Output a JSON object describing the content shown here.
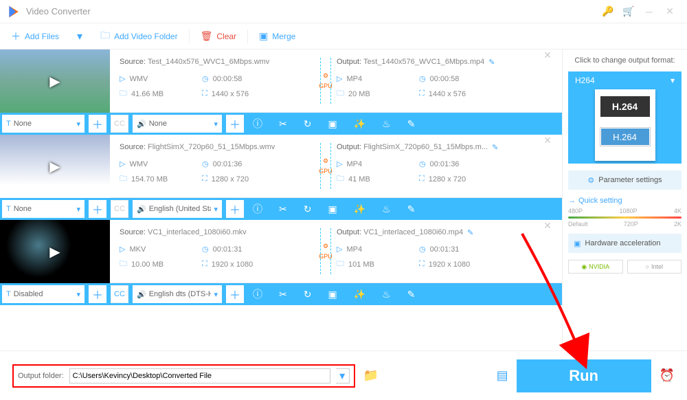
{
  "app": {
    "title": "Video Converter"
  },
  "toolbar": {
    "add_files": "Add Files",
    "add_folder": "Add Video Folder",
    "clear": "Clear",
    "merge": "Merge"
  },
  "rows": [
    {
      "source_label": "Source:",
      "source_name": "Test_1440x576_WVC1_6Mbps.wmv",
      "src_format": "WMV",
      "src_dur": "00:00:58",
      "src_size": "41.66 MB",
      "src_res": "1440 x 576",
      "output_label": "Output:",
      "output_name": "Test_1440x576_WVC1_6Mbps.mp4",
      "out_format": "MP4",
      "out_dur": "00:00:58",
      "out_size": "20 MB",
      "out_res": "1440 x 576",
      "subtitle": "None",
      "audio": "None",
      "cc_active": false,
      "gpu": "GPU"
    },
    {
      "source_label": "Source:",
      "source_name": "FlightSimX_720p60_51_15Mbps.wmv",
      "src_format": "WMV",
      "src_dur": "00:01:36",
      "src_size": "154.70 MB",
      "src_res": "1280 x 720",
      "output_label": "Output:",
      "output_name": "FlightSimX_720p60_51_15Mbps.m...",
      "out_format": "MP4",
      "out_dur": "00:01:36",
      "out_size": "41 MB",
      "out_res": "1280 x 720",
      "subtitle": "None",
      "audio": "English (United State",
      "cc_active": false,
      "gpu": "GPU"
    },
    {
      "source_label": "Source:",
      "source_name": "VC1_interlaced_1080i60.mkv",
      "src_format": "MKV",
      "src_dur": "00:01:31",
      "src_size": "10.00 MB",
      "src_res": "1920 x 1080",
      "output_label": "Output:",
      "output_name": "VC1_interlaced_1080i60.mp4",
      "out_format": "MP4",
      "out_dur": "00:01:31",
      "out_size": "101 MB",
      "out_res": "1920 x 1080",
      "subtitle": "Disabled",
      "audio": "English dts (DTS-HD",
      "cc_active": true,
      "gpu": "GPU"
    }
  ],
  "right": {
    "header": "Click to change output format:",
    "format_name": "H264",
    "badge1": "H.264",
    "badge2": "H.264",
    "param": "Parameter settings",
    "quick": "Quick setting",
    "ticks_top": [
      "480P",
      "1080P",
      "4K"
    ],
    "ticks_bottom": [
      "Default",
      "720P",
      "2K"
    ],
    "hw": "Hardware acceleration",
    "nvidia": "NVIDIA",
    "intel": "Intel"
  },
  "footer": {
    "label": "Output folder:",
    "path": "C:\\Users\\Kevincy\\Desktop\\Converted File",
    "run": "Run"
  }
}
